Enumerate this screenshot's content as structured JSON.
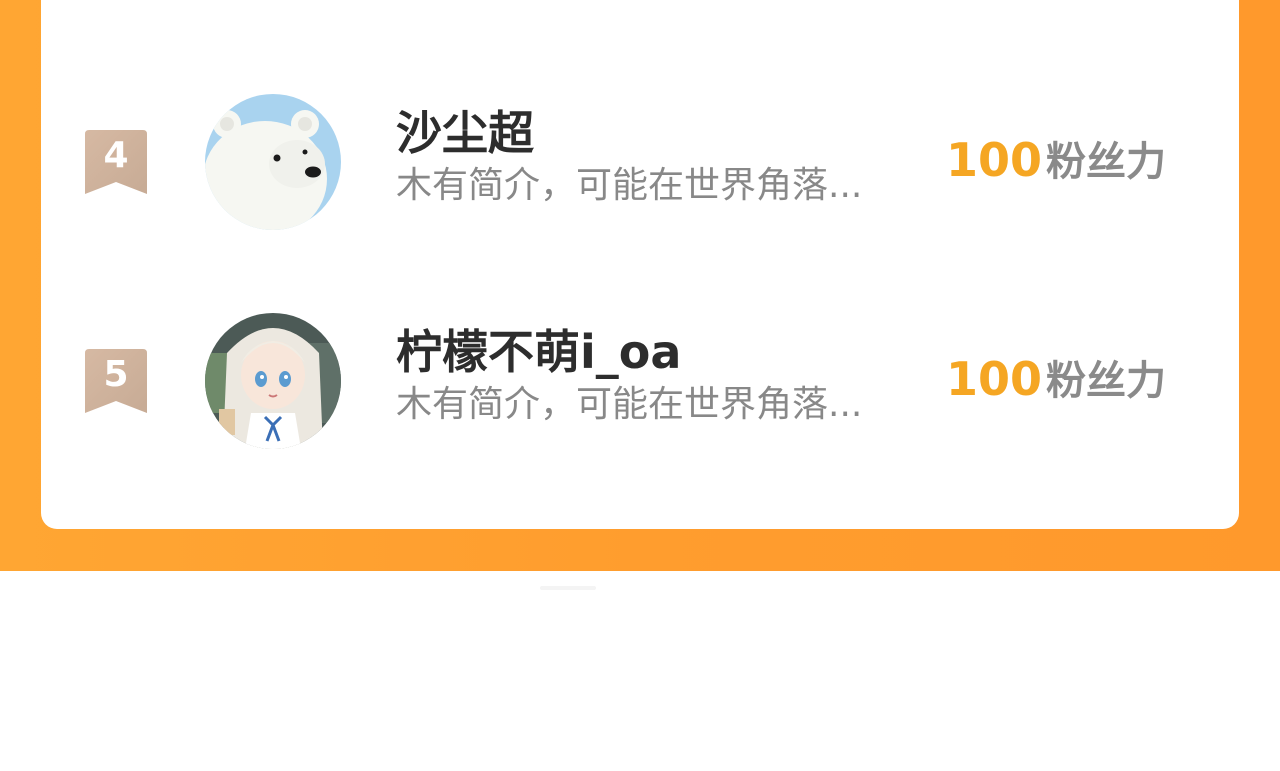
{
  "ranking": {
    "items": [
      {
        "rank": "4",
        "name": "沙尘超",
        "bio": "木有简介，可能在世界角落...",
        "score": "100",
        "score_unit": "粉丝力",
        "avatar_icon": "polar-bear-avatar"
      },
      {
        "rank": "5",
        "name": "柠檬不萌i_oa",
        "bio": "木有简介，可能在世界角落...",
        "score": "100",
        "score_unit": "粉丝力",
        "avatar_icon": "anime-girl-avatar"
      }
    ]
  },
  "colors": {
    "background_orange": "#ff9d2e",
    "score_gold": "#f5a623",
    "badge_bronze": "#c9ab95",
    "name_text": "#2d2d2d",
    "bio_text": "#888888"
  }
}
